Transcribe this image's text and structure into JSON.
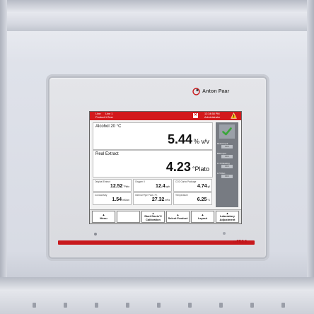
{
  "brand": {
    "name": "Anton Paar"
  },
  "model": "mPDS 5",
  "header": {
    "line_key": "Line:",
    "line_value": "Line 1",
    "product_key": "Product:",
    "product_value": "1 Beer",
    "close_glyph": "✕",
    "time": "12:34:58 PM",
    "user": "Administrator"
  },
  "measurements": [
    {
      "label": "Alcohol 20 °C",
      "value": "5.44",
      "unit": "% v/v"
    },
    {
      "label": "Real Extract",
      "value": "4.23",
      "unit": "°Plato"
    }
  ],
  "small_values": [
    {
      "label": "Original Extract",
      "value": "12.52",
      "unit": "°Plato"
    },
    {
      "label": "Oxygen II",
      "value": "12.4",
      "unit": "ppb"
    },
    {
      "label": "CO2 Carbo Package",
      "value": "4.74",
      "unit": "g/l"
    },
    {
      "label": "Conductivity",
      "value": "1.54",
      "unit": "mS/cm"
    },
    {
      "label": "Internal Pipe Pack. Pr.",
      "value": "27.32",
      "unit": "mPa"
    },
    {
      "label": "Temperature",
      "value": "6.25",
      "unit": "°C"
    }
  ],
  "side_items": [
    {
      "label": "Reset Input",
      "state": "OFF"
    },
    {
      "label": "Batt Input",
      "state": "OFF"
    },
    {
      "label": "Lt 4 Cleaning",
      "state": "OFF"
    },
    {
      "label": "Lt 5 Run",
      "state": "OFF"
    }
  ],
  "footer_buttons": [
    {
      "label": "Menu"
    },
    {
      "label": ""
    },
    {
      "label": "Start Davis'C Calibration"
    },
    {
      "label": "Select Product"
    },
    {
      "label": "Layout"
    },
    {
      "label": "Laboratory Adjustment"
    }
  ],
  "colors": {
    "accent": "#d3191c",
    "check": "#3aa63a"
  },
  "icons": [
    "warning-icon",
    "checkmark-icon",
    "close-icon",
    "anton-paar-logo-icon"
  ]
}
